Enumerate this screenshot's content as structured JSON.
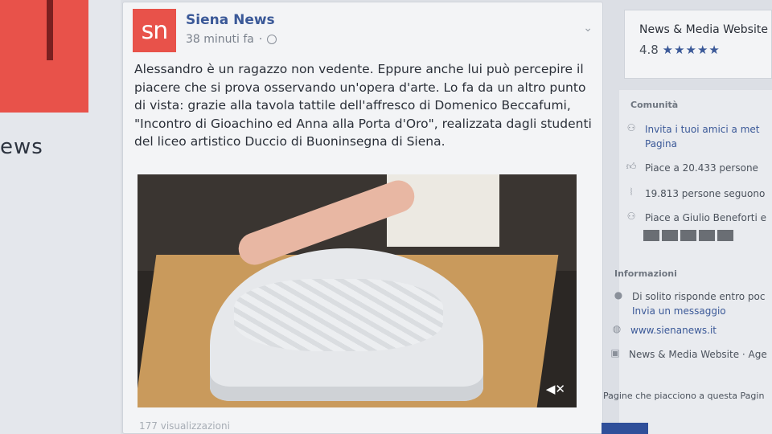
{
  "left": {
    "page_name_partial": "ews"
  },
  "post": {
    "avatar_text": "sn",
    "page_name": "Siena News",
    "time": "38 minuti fa",
    "text": "Alessandro è un ragazzo non vedente. Eppure anche lui può percepire il piacere che si prova osservando un'opera d'arte. Lo fa da un altro punto di vista: grazie alla tavola tattile dell'affresco di Domenico Beccafumi, \"Incontro di Gioachino ed Anna alla Porta d'Oro\", realizzata dagli studenti del liceo artistico Duccio di Buoninsegna di Siena.",
    "views": "177 visualizzazioni",
    "icons": [
      "globe-icon",
      "chevron-down-icon",
      "mute-icon"
    ]
  },
  "sidebar": {
    "rating_title": "News & Media Website",
    "rating_value": "4.8",
    "stars": "★★★★★",
    "community_title": "Comunità",
    "invite_line1": "Invita i tuoi amici a met",
    "invite_line2": "Pagina",
    "likes": "Piace a 20.433 persone",
    "followers": "19.813 persone seguono",
    "friends_like": "Piace a Giulio Beneforti e",
    "info_title": "Informazioni",
    "response_line1": "Di solito risponde entro poc",
    "response_line2": "Invia un messaggio",
    "website": "www.sienanews.it",
    "category": "News & Media Website · Age",
    "liked_pages": "Pagine che piacciono a questa Pagin"
  }
}
